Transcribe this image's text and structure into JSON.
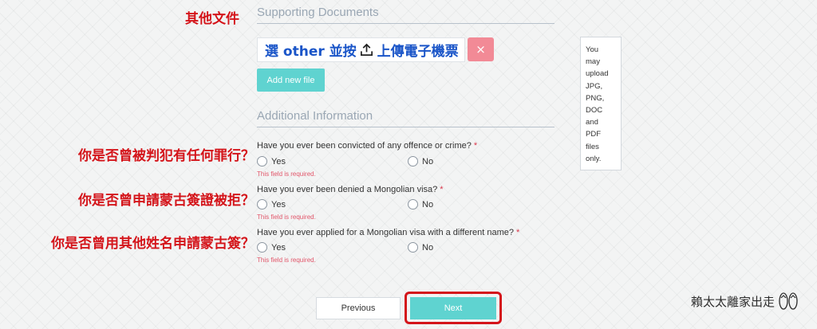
{
  "annotations": {
    "other_docs": "其他文件",
    "q1": "你是否曾被判犯有任何罪行？",
    "q2": "你是否曾申請蒙古簽證被拒？",
    "q3": "你是否曾用其他姓名申請蒙古簽？"
  },
  "supporting_documents": {
    "title": "Supporting Documents",
    "upload_text_before": "選 other 並按",
    "upload_icon": "upload-icon",
    "upload_text_after": "上傳電子機票",
    "remove_label": "×",
    "add_file_label": "Add new file"
  },
  "note": {
    "text": "You\nmay\nupload\nJPG,\nPNG,\nDOC\nand\nPDF\nfiles\nonly."
  },
  "additional_information": {
    "title": "Additional Information",
    "questions": [
      {
        "label": "Have you ever been convicted of any offence or crime?",
        "required_mark": "*",
        "yes_label": "Yes",
        "no_label": "No",
        "error": "This field is required."
      },
      {
        "label": "Have you ever been denied a Mongolian visa?",
        "required_mark": "*",
        "yes_label": "Yes",
        "no_label": "No",
        "error": "This field is required."
      },
      {
        "label": "Have you ever applied for a Mongolian visa with a different name?",
        "required_mark": "*",
        "yes_label": "Yes",
        "no_label": "No",
        "error": "This field is required."
      }
    ]
  },
  "navigation": {
    "previous_label": "Previous",
    "next_label": "Next"
  },
  "watermark": {
    "text": "賴太太離家出走"
  },
  "colors": {
    "annotation_red": "#d4141a",
    "accent_teal": "#5fd3d0",
    "remove_pink": "#f28a96",
    "upload_blue": "#1a55c8",
    "error_pink": "#e2566a"
  }
}
